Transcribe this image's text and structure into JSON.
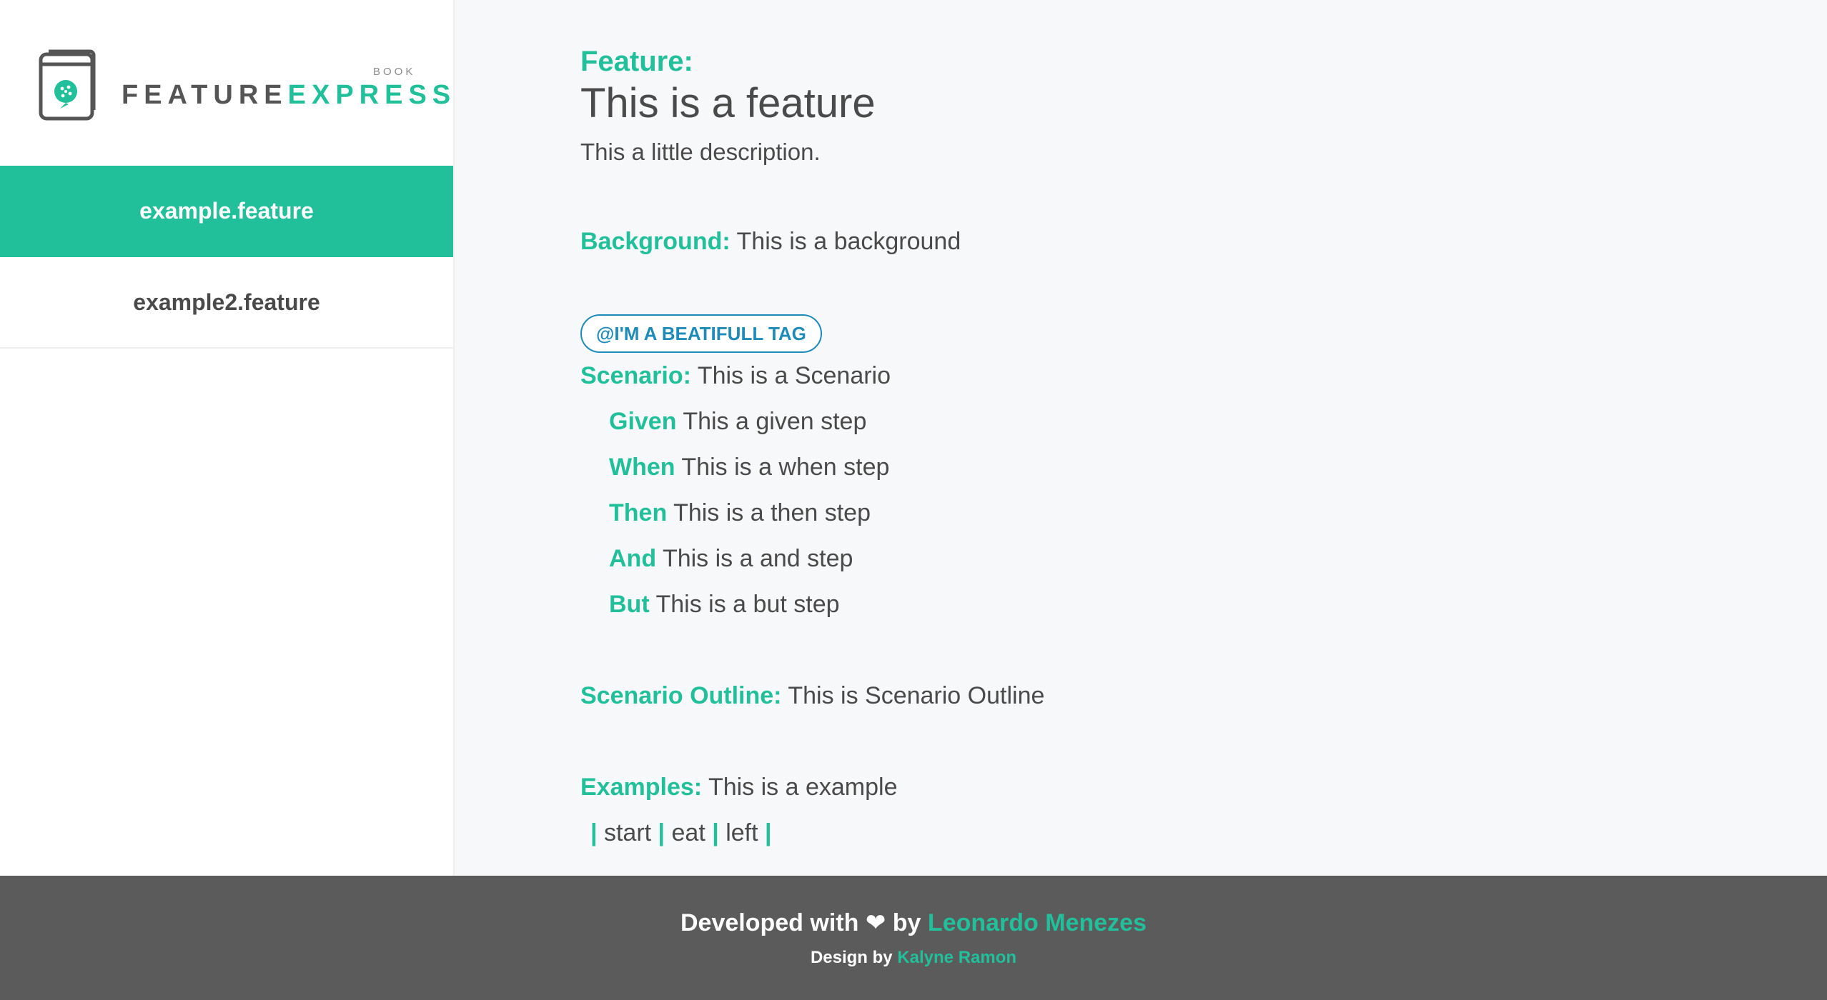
{
  "colors": {
    "accent": "#22bf9b",
    "tag": "#1e8bb8",
    "text": "#4a4a4a",
    "footer_bg": "#5b5b5b"
  },
  "logo": {
    "book": "BOOK",
    "word1": "FEATURE",
    "word2": "EXPRESS",
    "icon": "book-cucumber-icon"
  },
  "sidebar": {
    "items": [
      {
        "label": "example.feature",
        "active": true
      },
      {
        "label": "example2.feature",
        "active": false
      }
    ]
  },
  "feature": {
    "keyword": "Feature:",
    "title": "This is a feature",
    "description": "This a little description."
  },
  "background": {
    "keyword": "Background:",
    "text": "This is a background"
  },
  "tag": "@I'M A BEATIFULL TAG",
  "scenario": {
    "keyword": "Scenario:",
    "text": "This is a Scenario",
    "steps": [
      {
        "keyword": "Given",
        "text": "This a given step"
      },
      {
        "keyword": "When",
        "text": "This is a when step"
      },
      {
        "keyword": "Then",
        "text": "This is a then step"
      },
      {
        "keyword": "And",
        "text": "This is a and step"
      },
      {
        "keyword": "But",
        "text": "This is a but step"
      }
    ]
  },
  "outline": {
    "keyword": "Scenario Outline:",
    "text": "This is Scenario Outline"
  },
  "examples": {
    "keyword": "Examples:",
    "text": "This is a example",
    "header": [
      "start",
      "eat",
      "left"
    ]
  },
  "footer": {
    "line1_prefix": "Developed with",
    "heart": "❤",
    "line1_by": "by",
    "developer": "Leonardo Menezes",
    "line2_prefix": "Design by",
    "designer": "Kalyne Ramon"
  }
}
